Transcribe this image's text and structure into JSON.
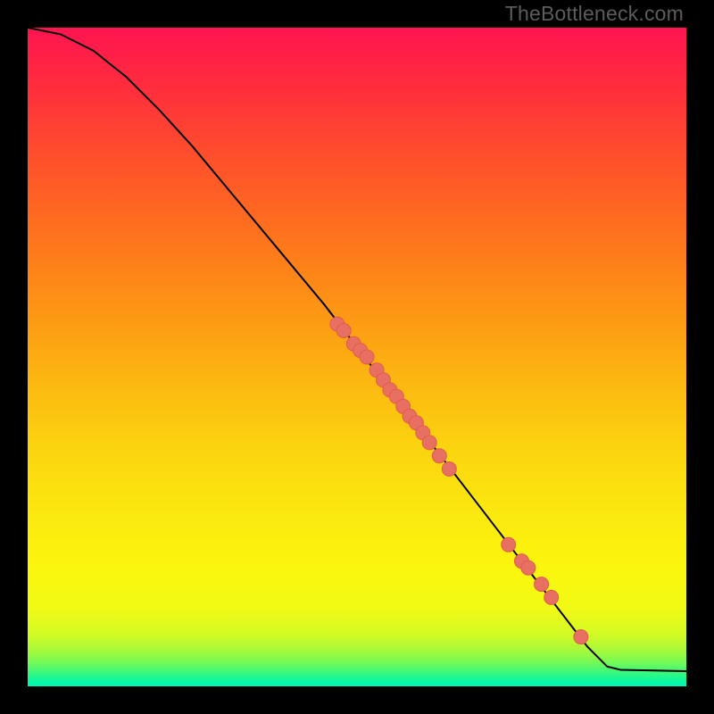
{
  "watermark": "TheBottleneck.com",
  "chart_data": {
    "type": "line",
    "title": "",
    "xlabel": "",
    "ylabel": "",
    "xlim": [
      0,
      100
    ],
    "ylim": [
      0,
      100
    ],
    "grid": false,
    "curve": [
      {
        "x": 0,
        "y": 100
      },
      {
        "x": 5,
        "y": 99
      },
      {
        "x": 10,
        "y": 96.5
      },
      {
        "x": 15,
        "y": 92.5
      },
      {
        "x": 20,
        "y": 87.5
      },
      {
        "x": 25,
        "y": 82
      },
      {
        "x": 30,
        "y": 76
      },
      {
        "x": 35,
        "y": 70
      },
      {
        "x": 40,
        "y": 64
      },
      {
        "x": 45,
        "y": 58
      },
      {
        "x": 50,
        "y": 51.5
      },
      {
        "x": 55,
        "y": 45
      },
      {
        "x": 60,
        "y": 38.5
      },
      {
        "x": 65,
        "y": 32
      },
      {
        "x": 70,
        "y": 25.5
      },
      {
        "x": 75,
        "y": 19
      },
      {
        "x": 80,
        "y": 12.5
      },
      {
        "x": 85,
        "y": 6
      },
      {
        "x": 88,
        "y": 3
      },
      {
        "x": 90,
        "y": 2.5
      },
      {
        "x": 95,
        "y": 2.4
      },
      {
        "x": 100,
        "y": 2.3
      }
    ],
    "scatter": [
      {
        "x": 47,
        "y": 55
      },
      {
        "x": 48,
        "y": 54
      },
      {
        "x": 49.5,
        "y": 52
      },
      {
        "x": 50.5,
        "y": 51
      },
      {
        "x": 51.5,
        "y": 50
      },
      {
        "x": 53,
        "y": 48
      },
      {
        "x": 54,
        "y": 46.5
      },
      {
        "x": 55,
        "y": 45
      },
      {
        "x": 56,
        "y": 44
      },
      {
        "x": 57,
        "y": 42.5
      },
      {
        "x": 58,
        "y": 41
      },
      {
        "x": 59,
        "y": 40
      },
      {
        "x": 60,
        "y": 38.5
      },
      {
        "x": 61,
        "y": 37
      },
      {
        "x": 62.5,
        "y": 35
      },
      {
        "x": 64,
        "y": 33
      },
      {
        "x": 73,
        "y": 21.5
      },
      {
        "x": 75,
        "y": 19
      },
      {
        "x": 76,
        "y": 18
      },
      {
        "x": 78,
        "y": 15.5
      },
      {
        "x": 79.5,
        "y": 13.5
      },
      {
        "x": 84,
        "y": 7.5
      }
    ]
  }
}
